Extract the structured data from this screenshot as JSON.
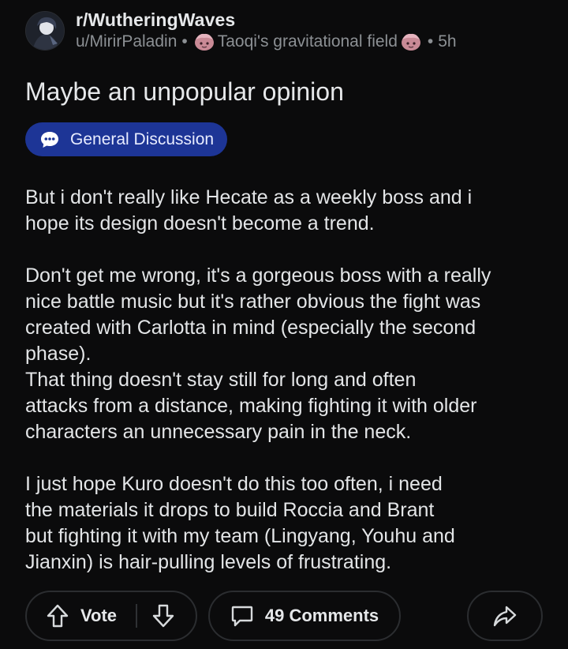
{
  "post": {
    "subreddit": "r/WutheringWaves",
    "author": "u/MirirPaladin",
    "separator": "•",
    "author_flair": "Taoqi's gravitational field",
    "age": "5h",
    "title": "Maybe an unpopular opinion",
    "flair": "General Discussion",
    "paragraphs": [
      {
        "lines": [
          "But i don't really like Hecate as a weekly boss and i",
          "hope its design doesn't become a trend."
        ]
      },
      {
        "lines": [
          "Don't get me wrong, it's a gorgeous boss with a really",
          "nice battle music but it's rather obvious the fight was",
          "created with Carlotta in mind (especially the second",
          "phase).",
          "That thing doesn't stay still for long and often",
          "attacks from a distance, making fighting it with older",
          "characters an unnecessary pain in the neck."
        ]
      },
      {
        "lines": [
          "I just hope Kuro doesn't do this too often, i need",
          "the materials it drops to build Roccia and Brant",
          "but fighting it with my team (Lingyang, Youhu and",
          "Jianxin) is hair-pulling levels of frustrating."
        ]
      }
    ]
  },
  "actions": {
    "vote_label": "Vote",
    "comments_label": "49 Comments"
  },
  "colors": {
    "background": "#0b0b0c",
    "flair_bg": "#1d3596",
    "text": "#e3e5e7",
    "muted": "#8c9094"
  },
  "icons": {
    "subreddit_avatar": "subreddit-avatar-icon",
    "user_flair": "taoqi-flair-icon",
    "flair": "chat-bubble-icon",
    "upvote": "arrow-up-icon",
    "downvote": "arrow-down-icon",
    "comments": "comment-icon",
    "share": "share-icon"
  }
}
